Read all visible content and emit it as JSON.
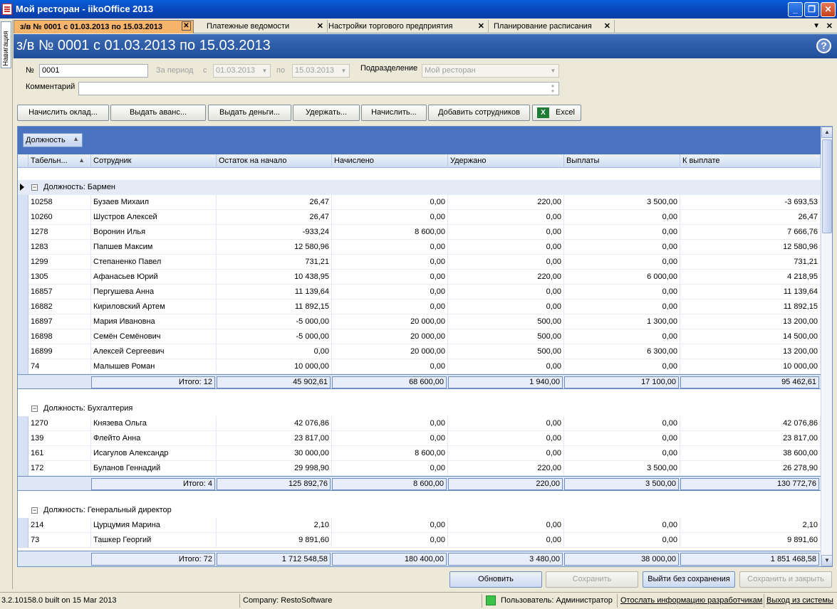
{
  "window": {
    "title": "Мой ресторан - iikoOffice 2013",
    "minimize": "_",
    "maximize": "❐",
    "close": "✕"
  },
  "nav": {
    "label": "Навигация"
  },
  "tabs": [
    {
      "label": "з/в № 0001 с 01.03.2013 по 15.03.2013",
      "active": true
    },
    {
      "label": "Платежные ведомости",
      "active": false
    },
    {
      "label": "Настройки торгового предприятия",
      "active": false
    },
    {
      "label": "Планирование расписания",
      "active": false
    }
  ],
  "tab_close_glyph": "✕",
  "tab_menu_glyph": "▼",
  "doc": {
    "title": "з/в № 0001 с 01.03.2013 по 15.03.2013",
    "help": "?"
  },
  "form": {
    "number_label": "№",
    "number_value": "0001",
    "period_label": "За период",
    "from_label": "с",
    "from_value": "01.03.2013",
    "to_label": "по",
    "to_value": "15.03.2013",
    "division_label": "Подразделение",
    "division_value": "Мой ресторан",
    "comment_label": "Комментарий",
    "comment_value": ""
  },
  "toolbar": {
    "accrue_salary": "Начислить оклад...",
    "issue_advance": "Выдать аванс...",
    "issue_money": "Выдать деньги...",
    "withhold": "Удержать...",
    "accrue": "Начислить...",
    "add_employees": "Добавить сотрудников",
    "excel": "Excel",
    "excel_icon": "X"
  },
  "grid": {
    "group_chip": "Должность",
    "columns": [
      "Табельн...",
      "Сотрудник",
      "Остаток на начало",
      "Начислено",
      "Удержано",
      "Выплаты",
      "К выплате"
    ],
    "groups": [
      {
        "title": "Должность: Бармен",
        "rows": [
          [
            "10258",
            "Бузаев Михаил",
            "26,47",
            "0,00",
            "220,00",
            "3 500,00",
            "-3 693,53"
          ],
          [
            "10260",
            "Шустров Алексей",
            "26,47",
            "0,00",
            "0,00",
            "0,00",
            "26,47"
          ],
          [
            "1278",
            "Воронин Илья",
            "-933,24",
            "8 600,00",
            "0,00",
            "0,00",
            "7 666,76"
          ],
          [
            "1283",
            "Папшев Максим",
            "12 580,96",
            "0,00",
            "0,00",
            "0,00",
            "12 580,96"
          ],
          [
            "1299",
            "Степаненко Павел",
            "731,21",
            "0,00",
            "0,00",
            "0,00",
            "731,21"
          ],
          [
            "1305",
            "Афанасьев Юрий",
            "10 438,95",
            "0,00",
            "220,00",
            "6 000,00",
            "4 218,95"
          ],
          [
            "16857",
            "Пергушева Анна",
            "11 139,64",
            "0,00",
            "0,00",
            "0,00",
            "11 139,64"
          ],
          [
            "16882",
            "Кириловский Артем",
            "11 892,15",
            "0,00",
            "0,00",
            "0,00",
            "11 892,15"
          ],
          [
            "16897",
            "Мария Ивановна",
            "-5 000,00",
            "20 000,00",
            "500,00",
            "1 300,00",
            "13 200,00"
          ],
          [
            "16898",
            "Семён Семёнович",
            "-5 000,00",
            "20 000,00",
            "500,00",
            "0,00",
            "14 500,00"
          ],
          [
            "16899",
            "Алексей Сергеевич",
            "0,00",
            "20 000,00",
            "500,00",
            "6 300,00",
            "13 200,00"
          ],
          [
            "74",
            "Малышев Роман",
            "10 000,00",
            "0,00",
            "0,00",
            "0,00",
            "10 000,00"
          ]
        ],
        "summary": [
          "Итого: 12",
          "45 902,61",
          "68 600,00",
          "1 940,00",
          "17 100,00",
          "95 462,61"
        ]
      },
      {
        "title": "Должность: Бухгалтерия",
        "rows": [
          [
            "1270",
            "Князева Ольга",
            "42 076,86",
            "0,00",
            "0,00",
            "0,00",
            "42 076,86"
          ],
          [
            "139",
            "Флейто Анна",
            "23 817,00",
            "0,00",
            "0,00",
            "0,00",
            "23 817,00"
          ],
          [
            "161",
            "Исагулов Александр",
            "30 000,00",
            "8 600,00",
            "0,00",
            "0,00",
            "38 600,00"
          ],
          [
            "172",
            "Буланов Геннадий",
            "29 998,90",
            "0,00",
            "220,00",
            "3 500,00",
            "26 278,90"
          ]
        ],
        "summary": [
          "Итого: 4",
          "125 892,76",
          "8 600,00",
          "220,00",
          "3 500,00",
          "130 772,76"
        ]
      },
      {
        "title": "Должность: Генеральный директор",
        "rows": [
          [
            "214",
            "Цурцумия Марина",
            "2,10",
            "0,00",
            "0,00",
            "0,00",
            "2,10"
          ],
          [
            "73",
            "Ташкер Георгий",
            "9 891,60",
            "0,00",
            "0,00",
            "0,00",
            "9 891,60"
          ]
        ]
      }
    ],
    "total": [
      "Итого: 72",
      "1 712 548,58",
      "180 400,00",
      "3 480,00",
      "38 000,00",
      "1 851 468,58"
    ]
  },
  "footer_buttons": {
    "refresh": "Обновить",
    "save": "Сохранить",
    "exit_no_save": "Выйти без сохранения",
    "save_close": "Сохранить и закрыть"
  },
  "status": {
    "build": "3.2.10158.0 built on 15 Mar 2013",
    "company": "Company: RestoSoftware",
    "user": "Пользователь: Администратор",
    "send_info": "Отослать информацию разработчикам",
    "logout": "Выход из системы"
  }
}
